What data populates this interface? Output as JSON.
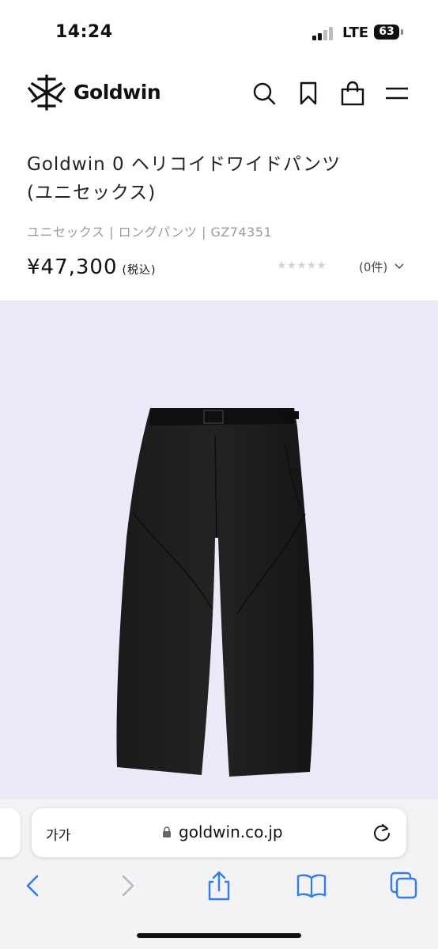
{
  "status_bar": {
    "time": "14:24",
    "network": "LTE",
    "battery": "63"
  },
  "header": {
    "brand": "Goldwin",
    "icons": [
      "search-icon",
      "bookmark-icon",
      "bag-icon",
      "menu-icon"
    ]
  },
  "product": {
    "title_line1": "Goldwin 0 ヘリコイドワイドパンツ",
    "title_line2": "(ユニセックス)",
    "breadcrumb": "ユニセックス | ロングパンツ | GZ74351",
    "price": "¥47,300",
    "tax_note": "(税込)",
    "rating_stars": "★★★★★",
    "rating_value": 0,
    "reviews": "(0件)"
  },
  "colors": {
    "image_bg": "#e9e9f7",
    "browser_accent": "#2f7cf6"
  },
  "browser": {
    "text_size_label": "가가",
    "url": "goldwin.co.jp",
    "icons": [
      "back-icon",
      "forward-icon",
      "share-icon",
      "bookmarks-icon",
      "tabs-icon"
    ]
  }
}
